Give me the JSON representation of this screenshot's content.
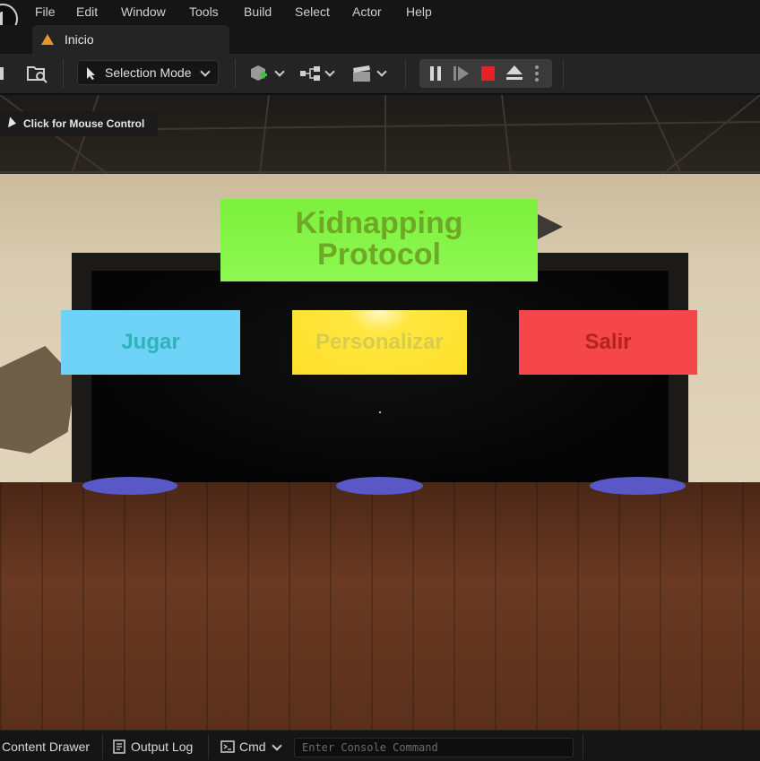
{
  "menu": {
    "items": [
      "File",
      "Edit",
      "Window",
      "Tools",
      "Build",
      "Select",
      "Actor",
      "Help"
    ]
  },
  "tab": {
    "label": "Inicio"
  },
  "toolbar": {
    "selection_mode": "Selection Mode"
  },
  "viewport": {
    "mouse_control": "Click for Mouse Control",
    "title_line1": "Kidnapping",
    "title_line2": "Protocol",
    "buttons": {
      "jugar": "Jugar",
      "personalizar": "Personalizar",
      "salir": "Salir"
    }
  },
  "statusbar": {
    "content_drawer": "Content Drawer",
    "output_log": "Output Log",
    "cmd": "Cmd",
    "console_placeholder": "Enter Console Command"
  },
  "colors": {
    "title_panel": "#8ef852",
    "jugar": "#6ed3f7",
    "personalizar": "#ffe02a",
    "salir": "#f5464a",
    "stop": "#e8202a"
  }
}
